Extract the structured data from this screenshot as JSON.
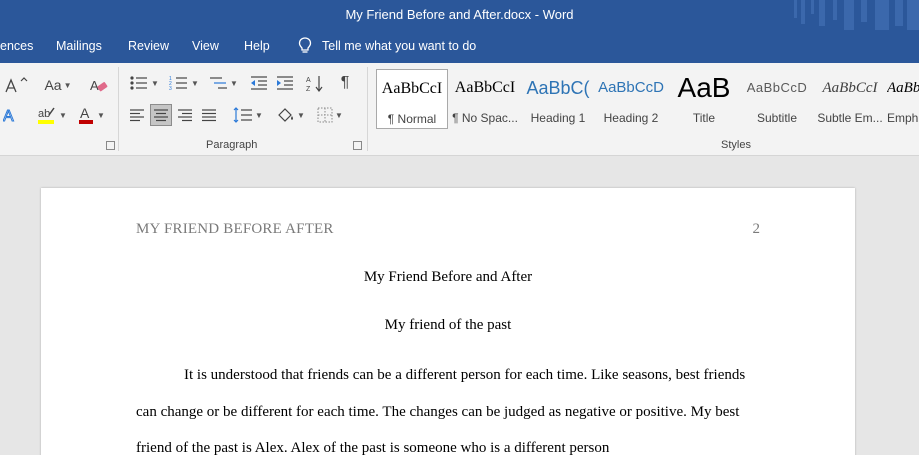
{
  "window": {
    "title": "My Friend Before and After.docx  -  Word"
  },
  "tabs": [
    {
      "label": "ences"
    },
    {
      "label": "Mailings"
    },
    {
      "label": "Review"
    },
    {
      "label": "View"
    },
    {
      "label": "Help"
    }
  ],
  "tell_me": {
    "label": "Tell me what you want to do"
  },
  "ribbon": {
    "font_group": {
      "change_case": "Aa",
      "font_color_hex": "#c00000",
      "highlight_color_hex": "#ffff00"
    },
    "paragraph_group": {
      "label": "Paragraph"
    },
    "styles_group": {
      "label": "Styles",
      "items": [
        {
          "sample": "AaBbCcI",
          "name": "¶ Normal",
          "selected": true
        },
        {
          "sample": "AaBbCcI",
          "name": "¶ No Spac..."
        },
        {
          "sample": "AaBbC(",
          "name": "Heading 1"
        },
        {
          "sample": "AaBbCcD",
          "name": "Heading 2"
        },
        {
          "sample": "AaB",
          "name": "Title"
        },
        {
          "sample": "AaBbCcD",
          "name": "Subtitle"
        },
        {
          "sample": "AaBbCcI",
          "name": "Subtle Em..."
        },
        {
          "sample": "AaBb",
          "name": "Emph"
        }
      ]
    }
  },
  "document": {
    "running_head": "MY FRIEND BEFORE AFTER",
    "page_number": "2",
    "title": "My Friend Before and After",
    "subtitle": "My friend of the past",
    "paragraph": "It is understood that friends can be a different person for each time. Like seasons, best friends can change or be different for each time. The changes can be judged as negative or positive. My best friend of the past is Alex. Alex of the past is someone who is a different person"
  }
}
